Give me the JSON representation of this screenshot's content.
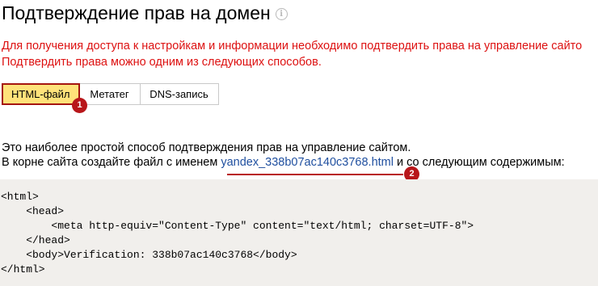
{
  "header": {
    "title": "Подтверждение прав на домен",
    "info_icon": "info-circle-icon"
  },
  "warning": {
    "line1": "Для получения доступа к настройкам и информации необходимо подтвердить права на управление сайто",
    "line2": "Подтвердить права можно одним из следующих способов.",
    "color": "#dd1111"
  },
  "tabs": [
    {
      "label": "HTML-файл",
      "active": true
    },
    {
      "label": "Метатег",
      "active": false
    },
    {
      "label": "DNS-запись",
      "active": false
    }
  ],
  "markers": {
    "m1": "1",
    "m2": "2",
    "color": "#b8161a"
  },
  "description": {
    "line1": "Это наиболее простой способ подтверждения прав на управление сайтом.",
    "line2_prefix": "В корне сайта создайте файл с именем ",
    "file_link": "yandex_338b07ac140c3768.html",
    "line2_suffix": " и со следующим содержимым:"
  },
  "code": {
    "lines": [
      "<html>",
      "    <head>",
      "        <meta http-equiv=\"Content-Type\" content=\"text/html; charset=UTF-8\">",
      "    </head>",
      "    <body>Verification: 338b07ac140c3768</body>",
      "</html>"
    ]
  }
}
